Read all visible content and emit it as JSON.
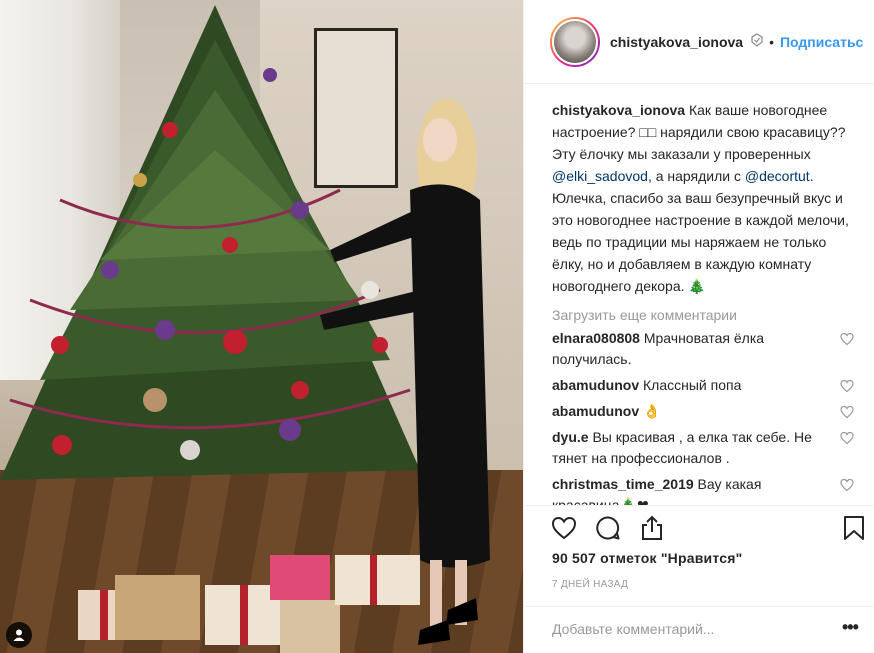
{
  "post": {
    "image_alt": "Woman in a black dress decorating a Christmas tree",
    "tagged_users_icon": "person-icon"
  },
  "header": {
    "username": "chistyakova_ionova",
    "verified_icon": "verified-icon",
    "separator": "•",
    "follow_label": "Подписатьс"
  },
  "caption": {
    "username": "chistyakova_ionova",
    "text_1": "Как ваше новогоднее настроение? ",
    "emoji_1": "□□",
    "text_2": " нарядили свою красавицу?? Эту ёлочку мы заказали у проверенных ",
    "mention_1": "@elki_sadovod",
    "text_3": ", а нарядили с ",
    "mention_2": "@decortut",
    "text_4": ". Юлечка, спасибо за ваш безупречный вкус и это новогоднее настроение в каждой мелочи, ведь по традиции мы наряжаем не только ёлку, но и добавляем в каждую комнату новогоднего декора. ",
    "emoji_2": "🎄"
  },
  "load_more_label": "Загрузить еще комментарии",
  "comments": [
    {
      "username": "elnara080808",
      "text": "Мрачноватая ёлка получилась."
    },
    {
      "username": "abamudunov",
      "text": "Классный попа"
    },
    {
      "username": "abamudunov",
      "text": "👌"
    },
    {
      "username": "dyu.e",
      "text": "Вы красивая , а елка так себе. Не тянет на профессионалов ."
    },
    {
      "username": "christmas_time_2019",
      "text": "Вау какая красавица🎄❤"
    }
  ],
  "actions": {
    "like_icon": "heart-icon",
    "comment_icon": "comment-icon",
    "share_icon": "share-icon",
    "save_icon": "bookmark-icon"
  },
  "likes_text": "90 507 отметок \"Нравится\"",
  "timestamp": "7 ДНЕЙ НАЗАД",
  "add_comment": {
    "placeholder": "Добавьте комментарий...",
    "more_label": "•••"
  },
  "colors": {
    "link": "#3897f0",
    "mention": "#003569",
    "muted": "#999999",
    "text": "#262626"
  }
}
